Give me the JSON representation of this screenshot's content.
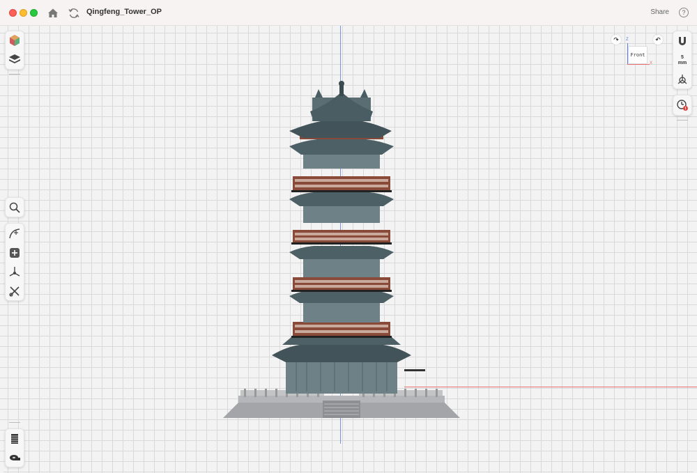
{
  "window": {
    "title": "Qingfeng_Tower_OP",
    "share_label": "Share",
    "help_label": "?"
  },
  "viewcube": {
    "face_label": "Front",
    "axis_z": "Z",
    "axis_x": "X"
  },
  "snap": {
    "value": "5",
    "unit": "mm"
  },
  "left_toolbar_top": [
    {
      "name": "appearance-icon"
    },
    {
      "name": "layers-icon"
    }
  ],
  "left_toolbar_mid": [
    {
      "name": "search-icon"
    },
    {
      "name": "sketch-curve-icon"
    },
    {
      "name": "add-primitive-icon"
    },
    {
      "name": "transform-icon"
    },
    {
      "name": "modify-tools-icon"
    }
  ],
  "left_toolbar_bottom": [
    {
      "name": "slicer-icon"
    },
    {
      "name": "measure-icon"
    }
  ],
  "right_toolbar": [
    {
      "name": "snap-magnet-icon"
    },
    {
      "name": "snap-value"
    },
    {
      "name": "origin-icon"
    },
    {
      "name": "history-warning-icon"
    }
  ],
  "colors": {
    "roof": "#4f6369",
    "roof_dark": "#3a4b50",
    "wall": "#6d7f84",
    "railing": "#8a4a3a",
    "railing_light": "#c9a99c",
    "base": "#9ea0a3",
    "axis_blue": "#5a7be0",
    "axis_red": "#e67070"
  }
}
